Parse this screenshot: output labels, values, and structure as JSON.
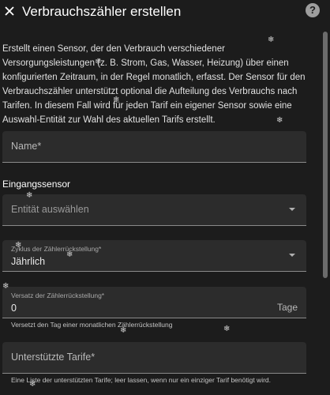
{
  "header": {
    "title": "Verbrauchszähler erstellen",
    "close_icon": "close-icon",
    "help_icon": "help-icon",
    "help_symbol": "?"
  },
  "description": "Erstellt einen Sensor, der den Verbrauch verschiedener Versorgungsleistungen (z. B. Strom, Gas, Wasser, Heizung) über einen konfigurierten Zeitraum, in der Regel monatlich, erfasst. Der Sensor für den Verbrauchszähler unterstützt optional die Aufteilung des Verbrauchs nach Tarifen. In diesem Fall wird für jeden Tarif ein eigener Sensor sowie eine Auswahl-Entität zur Wahl des aktuellen Tarifs erstellt.",
  "fields": {
    "name": {
      "label": "Name*",
      "value": ""
    },
    "section_input_sensor": "Eingangssensor",
    "entity": {
      "placeholder": "Entität auswählen"
    },
    "cycle": {
      "label": "Zyklus der Zählerrückstellung*",
      "value": "Jährlich"
    },
    "offset": {
      "label": "Versatz der Zählerrückstellung*",
      "value": "0",
      "suffix": "Tage",
      "helper": "Versetzt den Tag einer monatlichen Zählerrückstellung"
    },
    "tariffs": {
      "label": "Unterstützte Tarife*",
      "helper": "Eine Liste der unterstützten Tarife; leer lassen, wenn nur ein einziger Tarif benötigt wird."
    }
  },
  "colors": {
    "background": "#1c1c1c",
    "field_background": "#2c2c2c",
    "text": "#e1e1e1"
  }
}
